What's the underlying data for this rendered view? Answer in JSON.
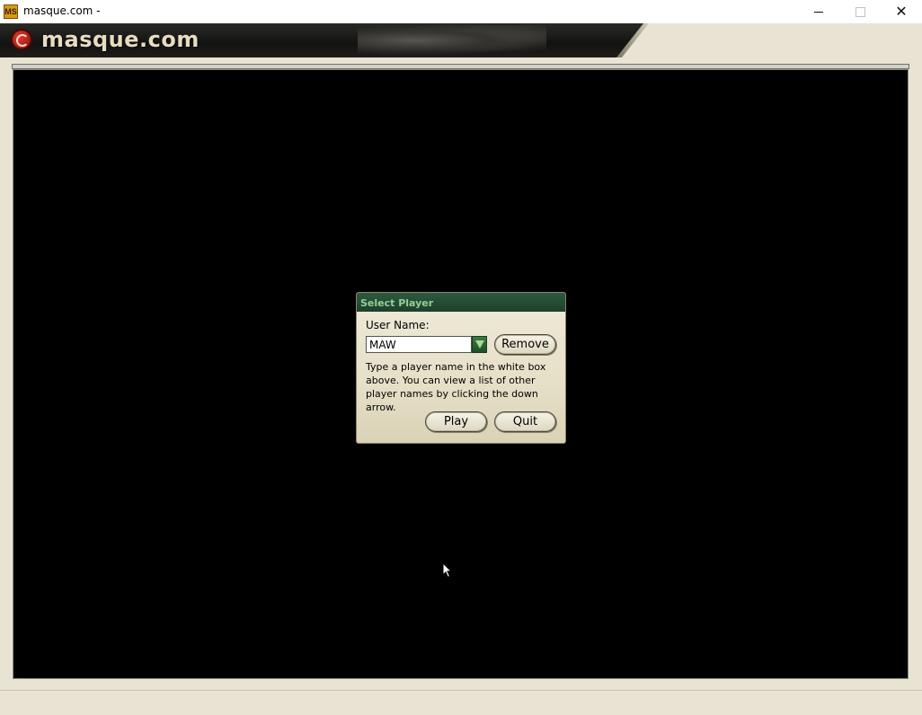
{
  "window": {
    "title": "masque.com -",
    "icon": "masque-app-icon",
    "icon_text": "MS",
    "minimize": "minimize-icon",
    "maximize": "maximize-icon",
    "close": "close-icon",
    "close_glyph": "✕"
  },
  "banner": {
    "logo_text": "masque.com"
  },
  "dialog": {
    "title": "Select Player",
    "user_name_label": "User Name:",
    "user_name_value": "MAW",
    "remove_label": "Remove",
    "help_text": "Type a player name in the white box above. You can view a list of other player names by clicking the down arrow.",
    "play_label": "Play",
    "quit_label": "Quit"
  },
  "colors": {
    "main_background": "#000000",
    "dialog_title_bg": "#1f3f2b",
    "dialog_title_text": "#8fd09a",
    "frame": "#e8e3d3"
  }
}
